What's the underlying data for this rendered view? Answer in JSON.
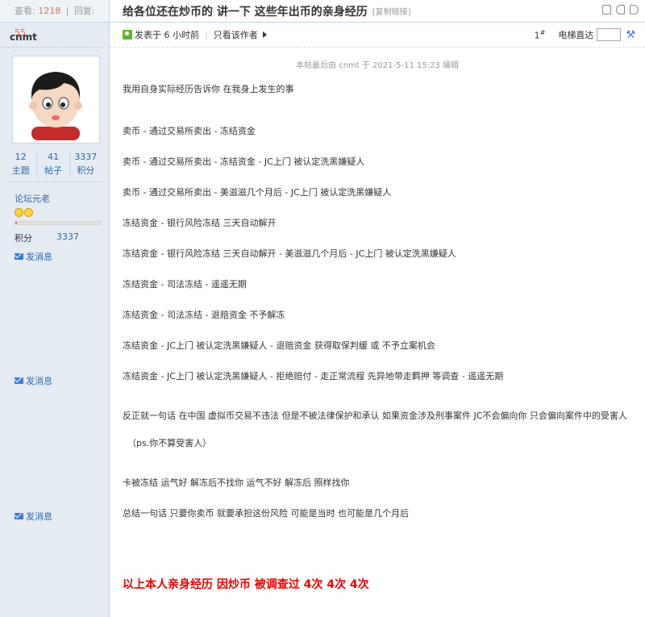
{
  "thread": {
    "views_label": "查看:",
    "views": "1218",
    "separator": "|",
    "replies_label": "回复:",
    "replies": "55",
    "title": "给各位还在炒币的 讲一下 这些年出币的亲身经历",
    "copy_link": "[复制链接]"
  },
  "author": {
    "name": "cnmt",
    "stats": [
      {
        "value": "12",
        "label": "主题"
      },
      {
        "value": "41",
        "label": "帖子"
      },
      {
        "value": "3337",
        "label": "积分"
      }
    ],
    "rank": "论坛元老",
    "level_progress": 0.02,
    "credits_label": "积分",
    "credits_value": "3337",
    "send_message": "发消息"
  },
  "post": {
    "posted": "发表于 6 小时前",
    "meta_sep": "|",
    "only_author": "只看该作者",
    "floor_num": "1",
    "floor_sup": "#",
    "goto_floor": "电梯直达",
    "edit_note": "本帖最后由 cnmt 于 2021-5-11 15:23 编辑",
    "lines": [
      "我用自身实际经历告诉你 在我身上发生的事",
      "卖币 - 通过交易所卖出 - 冻结资金",
      "卖币 - 通过交易所卖出 - 冻结资金 - JC上门 被认定洗黑嫌疑人",
      "卖币 - 通过交易所卖出 - 美滋滋几个月后 - JC上门 被认定洗黑嫌疑人",
      "冻结资金 - 银行风险冻结 三天自动解开",
      "冻结资金 - 银行风险冻结 三天自动解开 - 美滋滋几个月后 - JC上门 被认定洗黑嫌疑人",
      "冻结资金 - 司法冻结 - 遥遥无期",
      "冻结资金 - 司法冻结 - 退赔资金 不予解冻",
      "冻结资金 - JC上门 被认定洗黑嫌疑人 - 退赔资金  获得取保判缓 或 不予立案机会",
      "冻结资金 - JC上门 被认定洗黑嫌疑人 - 拒绝赔付 - 走正常流程  先异地带走羁押 等调查 - 遥遥无期",
      "反正就一句话 在中国 虚拟币交易不违法 但是不被法律保护和承认 如果资金涉及刑事案件  JC不会偏向你 只会偏向案件中的受害人",
      "（ps.你不算受害人）",
      "卡被冻结 运气好 解冻后不找你  运气不好 解冻后 照样找你",
      "总结一句话  只要你卖币 就要承担这份风险 可能是当时 也可能是几个月后"
    ],
    "final_red": "以上本人亲身经历 因炒币 被调查过 4次  4次 4次"
  },
  "colors": {
    "accent_blue": "#2e66a7",
    "red": "#ee0000",
    "count_red": "#f26c4f"
  }
}
